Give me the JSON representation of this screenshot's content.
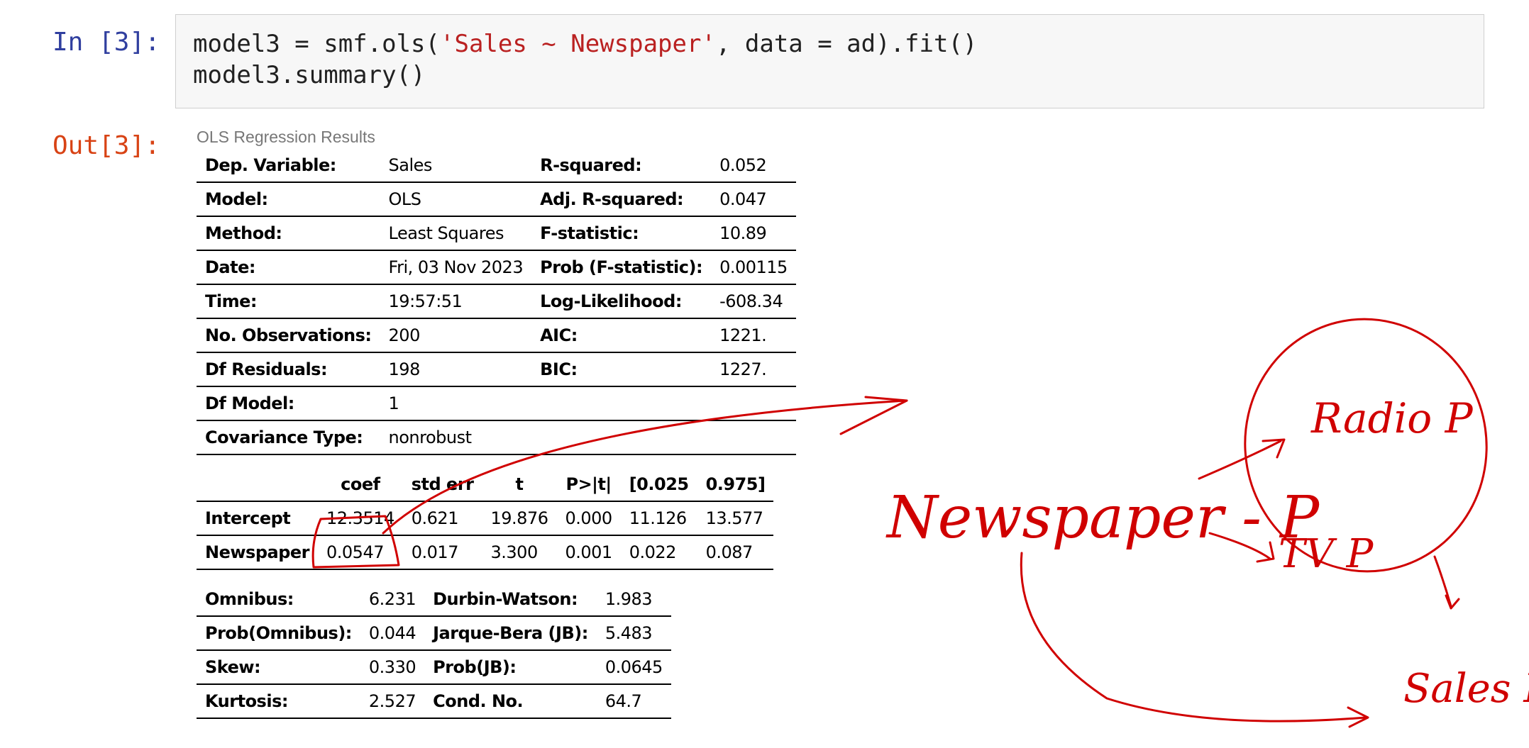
{
  "input_prompt": "In [3]:",
  "output_prompt": "Out[3]:",
  "code": {
    "line1": {
      "pre": "model3 = smf.ols(",
      "str": "'Sales ~ Newspaper'",
      "post": ", data = ad).fit()"
    },
    "line2": "model3.summary()"
  },
  "summary": {
    "caption": "OLS Regression Results",
    "info_rows": [
      {
        "l1": "Dep. Variable:",
        "v1": "Sales",
        "l2": "R-squared:",
        "v2": "0.052"
      },
      {
        "l1": "Model:",
        "v1": "OLS",
        "l2": "Adj. R-squared:",
        "v2": "0.047"
      },
      {
        "l1": "Method:",
        "v1": "Least Squares",
        "l2": "F-statistic:",
        "v2": "10.89"
      },
      {
        "l1": "Date:",
        "v1": "Fri, 03 Nov 2023",
        "l2": "Prob (F-statistic):",
        "v2": "0.00115"
      },
      {
        "l1": "Time:",
        "v1": "19:57:51",
        "l2": "Log-Likelihood:",
        "v2": "-608.34"
      },
      {
        "l1": "No. Observations:",
        "v1": "200",
        "l2": "AIC:",
        "v2": "1221."
      },
      {
        "l1": "Df Residuals:",
        "v1": "198",
        "l2": "BIC:",
        "v2": "1227."
      },
      {
        "l1": "Df Model:",
        "v1": "1",
        "l2": "",
        "v2": ""
      },
      {
        "l1": "Covariance Type:",
        "v1": "nonrobust",
        "l2": "",
        "v2": ""
      }
    ],
    "coef_headers": [
      "",
      "coef",
      "std err",
      "t",
      "P>|t|",
      "[0.025",
      "0.975]"
    ],
    "coef_rows": [
      [
        "Intercept",
        "12.3514",
        "0.621",
        "19.876",
        "0.000",
        "11.126",
        "13.577"
      ],
      [
        "Newspaper",
        "0.0547",
        "0.017",
        "3.300",
        "0.001",
        "0.022",
        "0.087"
      ]
    ],
    "diag_rows": [
      {
        "l1": "Omnibus:",
        "v1": "6.231",
        "l2": "Durbin-Watson:",
        "v2": "1.983"
      },
      {
        "l1": "Prob(Omnibus):",
        "v1": "0.044",
        "l2": "Jarque-Bera (JB):",
        "v2": "5.483"
      },
      {
        "l1": "Skew:",
        "v1": "0.330",
        "l2": "Prob(JB):",
        "v2": "0.0645"
      },
      {
        "l1": "Kurtosis:",
        "v1": "2.527",
        "l2": "Cond. No.",
        "v2": "64.7"
      }
    ]
  },
  "annotations": {
    "color": "#d00000",
    "newspaper": "Newspaper - P",
    "radio": "Radio P",
    "tv": "TV P",
    "sales": "Sales P"
  }
}
